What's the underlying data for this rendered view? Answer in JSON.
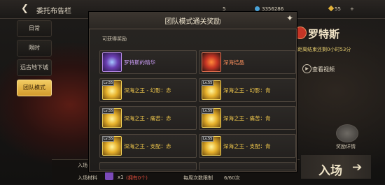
{
  "header": {
    "title": "委托布告栏",
    "resources": [
      {
        "value": "5"
      },
      {
        "value": "3356286"
      },
      {
        "value": "55"
      },
      {
        "value": "+"
      }
    ]
  },
  "sidebar": {
    "items": [
      {
        "label": "日常"
      },
      {
        "label": "限时"
      },
      {
        "label": "远古地下城"
      },
      {
        "label": "团队模式"
      }
    ],
    "active_index": 3
  },
  "boss": {
    "name": "罗特斯",
    "timer": "距离结束还剩0小时53分",
    "video_label": "查看视频",
    "reward_preview_label": "奖励详情"
  },
  "entry": {
    "label_top": "入场",
    "label_ticket": "入场材料",
    "ticket_count": "x1",
    "ticket_owned": "(拥有0个)",
    "weekly_label": "每周次数限制",
    "weekly_value": "6/60次",
    "enter_label": "入场",
    "enter_arrow": "➔"
  },
  "modal": {
    "title": "团队模式通关奖励",
    "section_label": "可获得奖励",
    "close_icon": "✦",
    "rewards": [
      {
        "name": "罗特斯的精华",
        "icon": "purple-orb-icon",
        "level": ""
      },
      {
        "name": "深海结晶",
        "icon": "red-crystal-icon",
        "level": ""
      },
      {
        "name": "深海之王 - 幻影：赤",
        "icon": "gold-gear-icon",
        "level": "Lv.55"
      },
      {
        "name": "深海之王 - 幻影：青",
        "icon": "gold-gear-icon",
        "level": "Lv.55"
      },
      {
        "name": "深海之王 - 痛苦：赤",
        "icon": "gold-gear-icon",
        "level": "Lv.55"
      },
      {
        "name": "深海之王 - 痛苦：青",
        "icon": "gold-gear-icon",
        "level": "Lv.55"
      },
      {
        "name": "深海之王 - 支配：赤",
        "icon": "gold-gear-icon",
        "level": "Lv.55"
      },
      {
        "name": "深海之王 - 支配：青",
        "icon": "gold-gear-icon",
        "level": "Lv.55"
      }
    ]
  }
}
